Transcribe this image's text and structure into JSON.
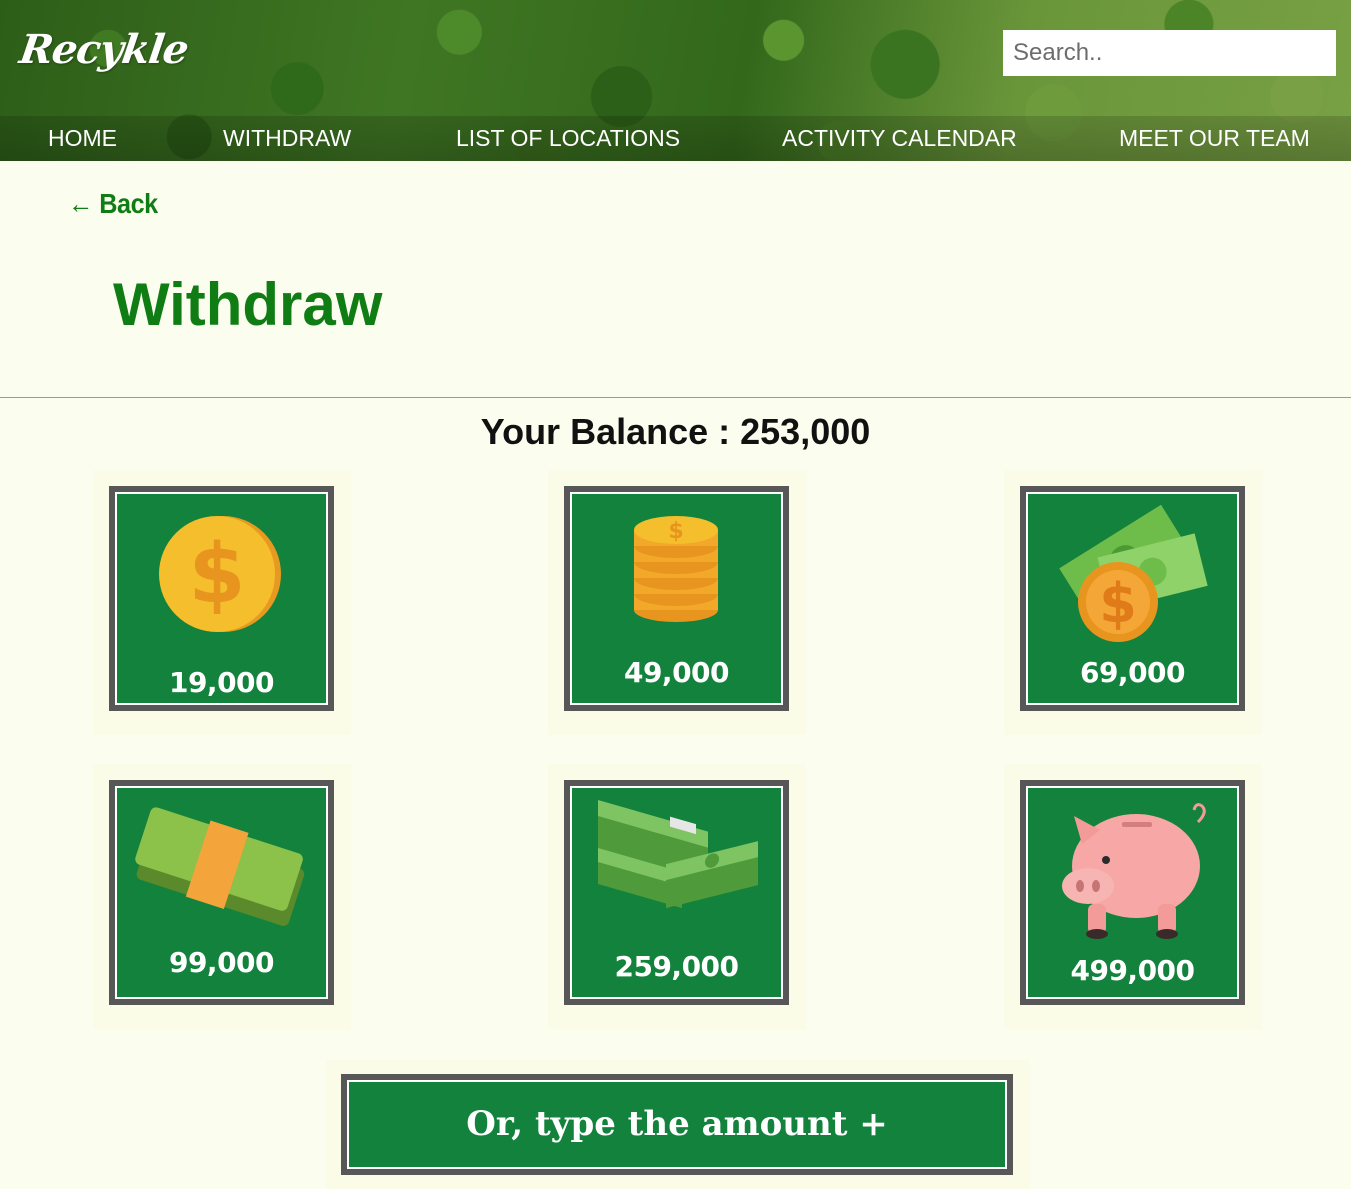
{
  "header": {
    "logo": "Recykle",
    "search_placeholder": "Search..",
    "nav": [
      "HOME",
      "WITHDRAW",
      "LIST OF LOCATIONS",
      "ACTIVITY CALENDAR",
      "MEET OUR TEAM"
    ]
  },
  "main": {
    "back_label": "← Back",
    "title": "Withdraw",
    "balance": "Your Balance : 253,000",
    "options": [
      {
        "amount": "19,000",
        "icon": "gold-coin-icon"
      },
      {
        "amount": "49,000",
        "icon": "coin-stack-icon"
      },
      {
        "amount": "69,000",
        "icon": "cash-and-coin-icon"
      },
      {
        "amount": "99,000",
        "icon": "money-bundle-icon"
      },
      {
        "amount": "259,000",
        "icon": "cash-stacks-icon"
      },
      {
        "amount": "499,000",
        "icon": "piggy-bank-icon"
      }
    ],
    "custom_label": "Or, type the amount +"
  },
  "colors": {
    "accent": "#0f7d13",
    "card": "#12823c",
    "card_border": "#575757",
    "background": "#fbfdee"
  }
}
